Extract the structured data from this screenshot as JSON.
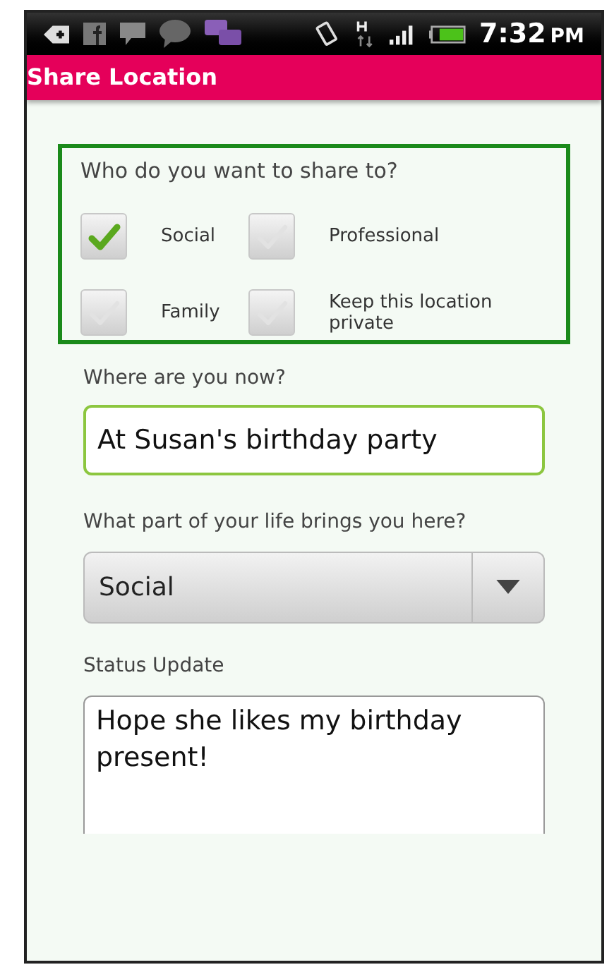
{
  "status_bar": {
    "time": "7:32",
    "meridiem": "PM"
  },
  "title_bar": {
    "title": "Share Location"
  },
  "share_group": {
    "question": "Who do you want to share to?",
    "options": [
      {
        "label": "Social",
        "checked": true
      },
      {
        "label": "Professional",
        "checked": false
      },
      {
        "label": "Family",
        "checked": false
      },
      {
        "label": "Keep this location private",
        "checked": false
      }
    ]
  },
  "location": {
    "label": "Where are you now?",
    "value": "At Susan's birthday party"
  },
  "life_part": {
    "label": "What part of your life brings you here?",
    "value": "Social"
  },
  "status_update": {
    "label": "Status Update",
    "value": "Hope she likes my birthday present!"
  }
}
